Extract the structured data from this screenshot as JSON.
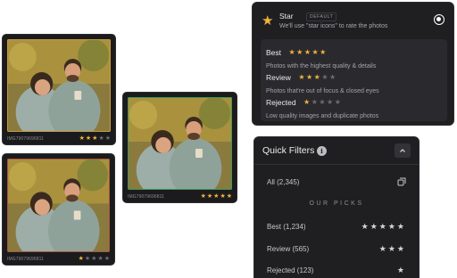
{
  "photos": [
    {
      "filename": "IMG79079696811",
      "rating": 3,
      "stars": [
        "★",
        "★",
        "★",
        "★",
        "★"
      ]
    },
    {
      "filename": "IMG79079696811",
      "rating": 1,
      "stars": [
        "★",
        "★",
        "★",
        "★",
        "★"
      ]
    },
    {
      "filename": "IMG79079696811",
      "rating": 5,
      "stars": [
        "★",
        "★",
        "★",
        "★",
        "★"
      ]
    }
  ],
  "rating_panel": {
    "icon": "star-icon",
    "title": "Star",
    "badge": "DEFAULT",
    "description": "We'll use \"star icons\" to rate the photos",
    "selected": true,
    "levels": [
      {
        "name": "Best",
        "stars": "★★★★★",
        "filled": 5,
        "description": "Photos with the highest quality & details"
      },
      {
        "name": "Review",
        "stars": "★★★",
        "empty": "★★",
        "filled": 3,
        "description": "Photos that're out of focus & closed eyes"
      },
      {
        "name": "Rejected",
        "stars": "★",
        "empty": "★★★★",
        "filled": 1,
        "description": "Low quality images and duplicate photos"
      }
    ]
  },
  "quick_filters": {
    "title": "Quick Filters",
    "info_glyph": "i",
    "all_label": "All (2,345)",
    "section_label": "OUR PICKS",
    "best": {
      "label": "Best (1,234)",
      "stars": "★★★★★"
    },
    "review": {
      "label": "Review (565)",
      "stars": "★★★"
    },
    "rejected": {
      "label": "Rejected (123)",
      "stars": "★"
    }
  },
  "colors": {
    "star_on": "#f2b33d",
    "star_off": "#6e6e72",
    "panel_bg": "#1f1f22"
  }
}
